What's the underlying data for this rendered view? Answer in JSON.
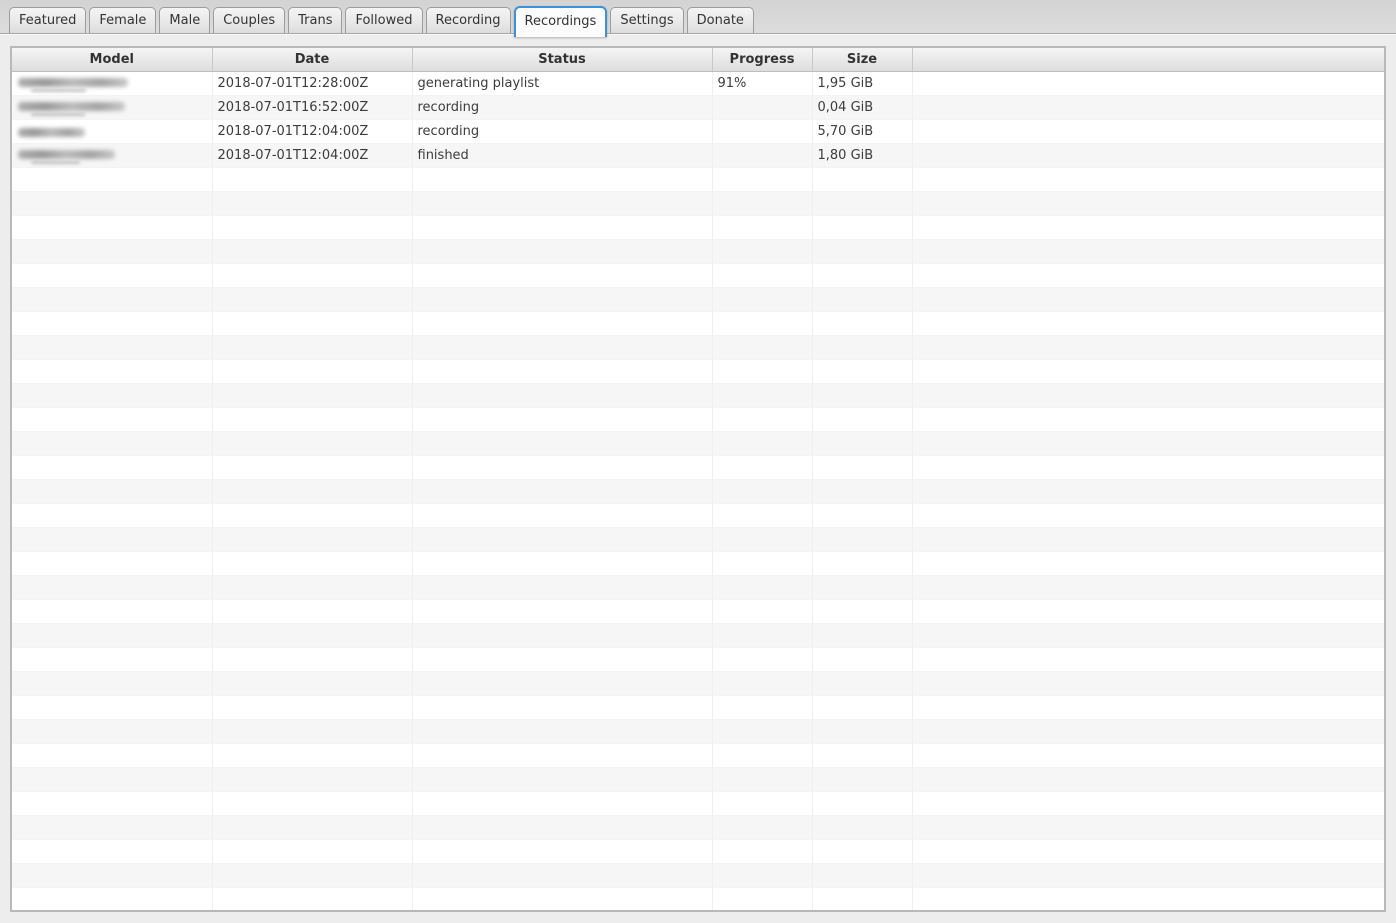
{
  "tabs": [
    {
      "label": "Featured",
      "selected": false
    },
    {
      "label": "Female",
      "selected": false
    },
    {
      "label": "Male",
      "selected": false
    },
    {
      "label": "Couples",
      "selected": false
    },
    {
      "label": "Trans",
      "selected": false
    },
    {
      "label": "Followed",
      "selected": false
    },
    {
      "label": "Recording",
      "selected": false
    },
    {
      "label": "Recordings",
      "selected": true
    },
    {
      "label": "Settings",
      "selected": false
    },
    {
      "label": "Donate",
      "selected": false
    }
  ],
  "table": {
    "columns": [
      "Model",
      "Date",
      "Status",
      "Progress",
      "Size",
      ""
    ],
    "rows": [
      {
        "model_redacted": true,
        "model_blur_width": 110,
        "model_blur_sub": true,
        "date": "2018-07-01T12:28:00Z",
        "status": "generating playlist",
        "progress": "91%",
        "size": "1,95 GiB"
      },
      {
        "model_redacted": true,
        "model_blur_width": 107,
        "model_blur_sub": true,
        "date": "2018-07-01T16:52:00Z",
        "status": "recording",
        "progress": "",
        "size": "0,04 GiB"
      },
      {
        "model_redacted": true,
        "model_blur_width": 67,
        "model_blur_sub": false,
        "date": "2018-07-01T12:04:00Z",
        "status": "recording",
        "progress": "",
        "size": "5,70 GiB"
      },
      {
        "model_redacted": true,
        "model_blur_width": 97,
        "model_blur_sub": true,
        "date": "2018-07-01T12:04:00Z",
        "status": "finished",
        "progress": "",
        "size": "1,80 GiB"
      }
    ],
    "empty_rows": 31
  },
  "colors": {
    "tab_focus_blue": "#3e92d2",
    "page_background": "#ededed",
    "tab_bar_background": "#d7d7d7",
    "row_stripe": "#f6f6f6"
  }
}
